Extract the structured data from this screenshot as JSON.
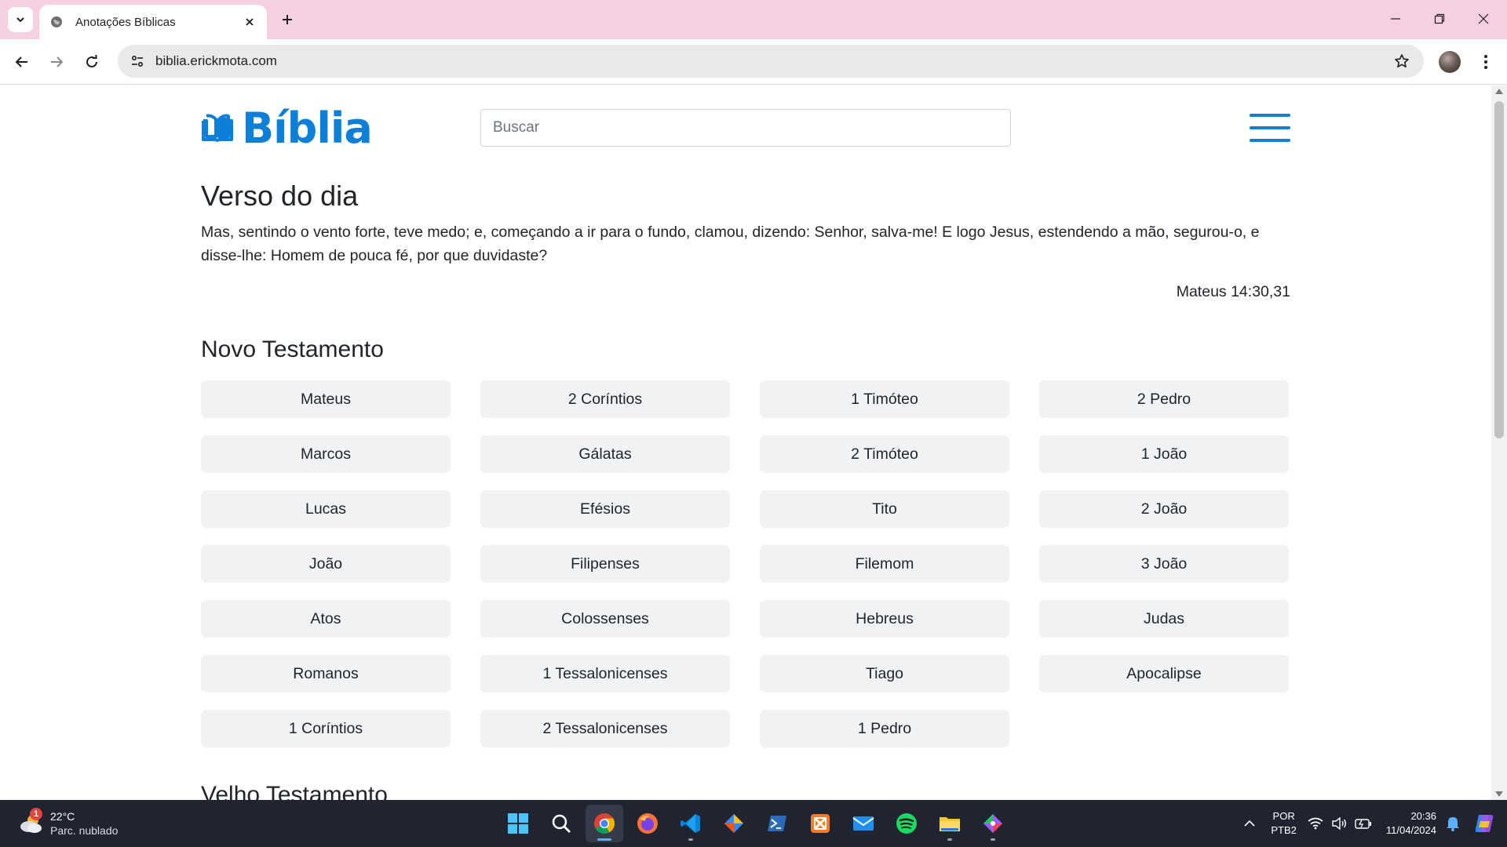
{
  "browser": {
    "tab_title": "Anotações Bíblicas",
    "url": "biblia.erickmota.com"
  },
  "site": {
    "logo_text": "Bíblia",
    "search_placeholder": "Buscar"
  },
  "verse_of_day": {
    "heading": "Verso do dia",
    "text": "Mas, sentindo o vento forte, teve medo; e, começando a ir para o fundo, clamou, dizendo: Senhor, salva-me! E logo Jesus, estendendo a mão, segurou-o, e disse-lhe: Homem de pouca fé, por que duvidaste?",
    "reference": "Mateus 14:30,31"
  },
  "new_testament": {
    "heading": "Novo Testamento",
    "books": [
      "Mateus",
      "Marcos",
      "Lucas",
      "João",
      "Atos",
      "Romanos",
      "1 Coríntios",
      "2 Coríntios",
      "Gálatas",
      "Efésios",
      "Filipenses",
      "Colossenses",
      "1 Tessalonicenses",
      "2 Tessalonicenses",
      "1 Timóteo",
      "2 Timóteo",
      "Tito",
      "Filemom",
      "Hebreus",
      "Tiago",
      "1 Pedro",
      "2 Pedro",
      "1 João",
      "2 João",
      "3 João",
      "Judas",
      "Apocalipse"
    ]
  },
  "old_testament": {
    "heading": "Velho Testamento"
  },
  "taskbar": {
    "weather_temp": "22°C",
    "weather_condition": "Parc. nublado",
    "weather_badge": "1",
    "lang_top": "POR",
    "lang_bottom": "PTB2",
    "time": "20:36",
    "date": "11/04/2024"
  }
}
